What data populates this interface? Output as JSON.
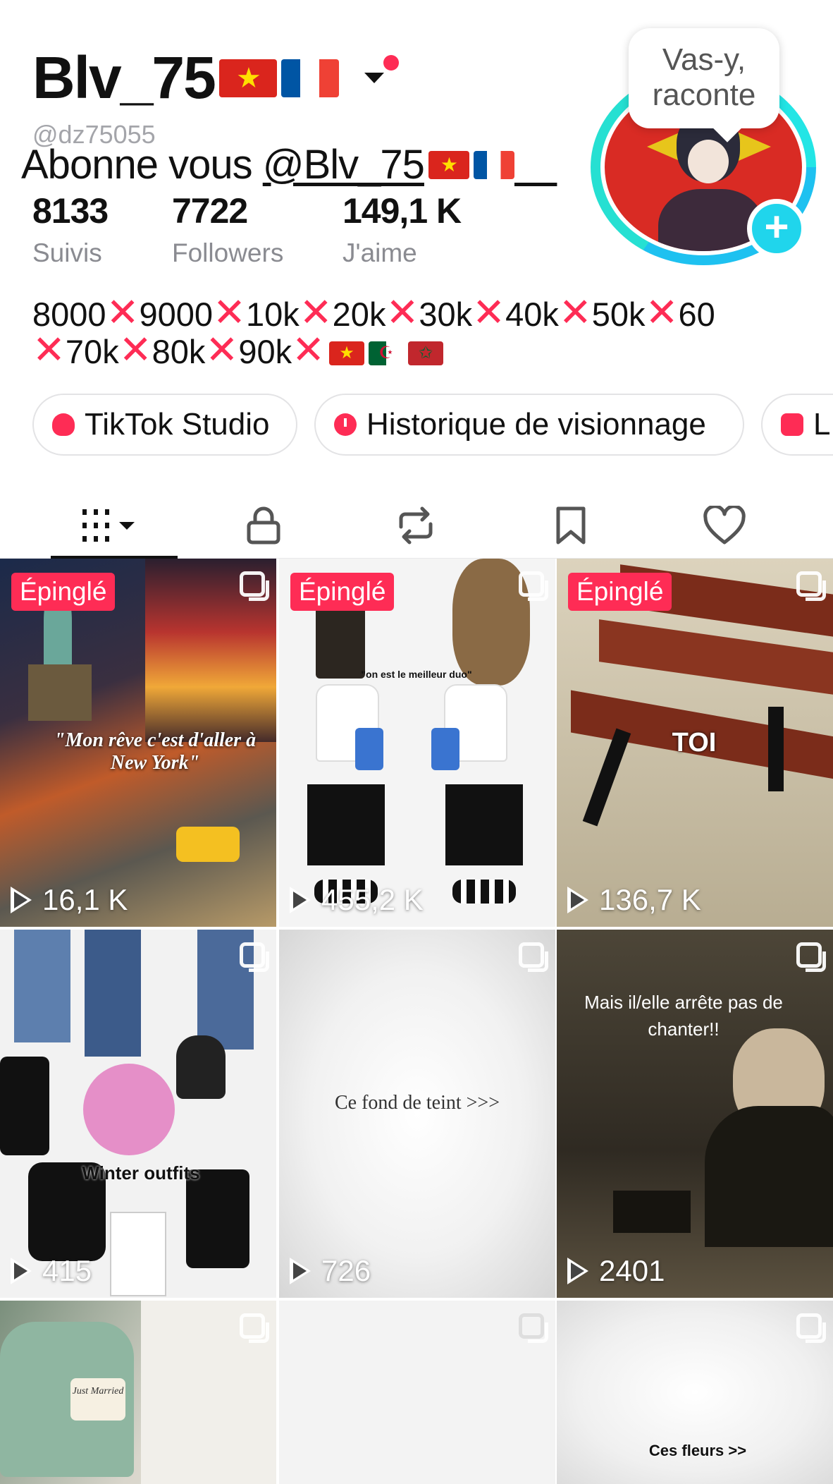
{
  "profile": {
    "display_name": "Blv_75",
    "username": "@dz75055",
    "overlay_text": "Abonne vous ",
    "overlay_mention": "@Blv_75",
    "story_prompt": "Vas-y, raconte"
  },
  "stats": [
    {
      "value": "8133",
      "label": "Suivis"
    },
    {
      "value": "7722",
      "label": "Followers"
    },
    {
      "value": "149,1 K",
      "label": "J'aime"
    }
  ],
  "bio": {
    "segments": [
      "8000",
      "9000",
      "10k",
      "20k",
      "30k",
      "40k",
      "50k",
      "60",
      "70k",
      "80k",
      "90k"
    ]
  },
  "chips": {
    "studio": "TikTok Studio",
    "history": "Historique de visionnage",
    "third": "LI"
  },
  "tabs": [
    "videos",
    "private",
    "reposts",
    "favorites",
    "liked"
  ],
  "grid": {
    "pinned_label": "Épinglé",
    "items": [
      {
        "views": "16,1 K",
        "caption": "\"Mon rêve c'est d'aller à New York\""
      },
      {
        "views": "455,2 K",
        "caption": "\"on est le meilleur duo\""
      },
      {
        "views": "136,7 K",
        "caption": "TOI"
      },
      {
        "views": "415",
        "caption": "Winter outfits"
      },
      {
        "views": "726",
        "caption": "Ce fond de teint >>>"
      },
      {
        "views": "2401",
        "caption": "Mais il/elle arrête pas de chanter!!"
      },
      {
        "views": "",
        "caption": "Just Married"
      },
      {
        "views": "",
        "caption": ""
      },
      {
        "views": "",
        "caption": "Ces fleurs >>"
      }
    ]
  },
  "colors": {
    "accent": "#fe2c55",
    "ring": "#20d5ec"
  }
}
